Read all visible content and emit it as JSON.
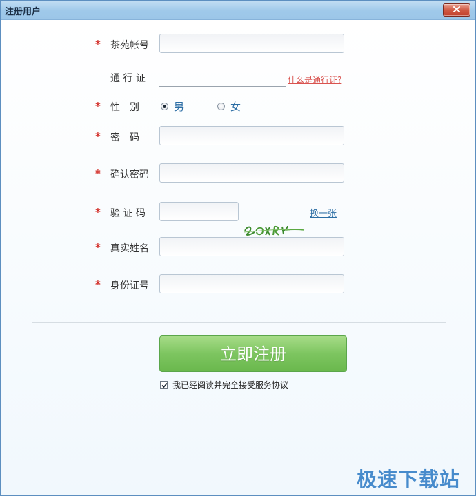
{
  "window": {
    "title": "注册用户"
  },
  "form": {
    "account": {
      "label": "茶苑帐号",
      "required_mark": "*",
      "value": ""
    },
    "passport": {
      "label": "通 行 证",
      "value": "",
      "help_link": "什么是通行证?"
    },
    "gender": {
      "label": "性　别",
      "required_mark": "*",
      "options": [
        {
          "label": "男",
          "selected": true
        },
        {
          "label": "女",
          "selected": false
        }
      ]
    },
    "password": {
      "label": "密　码",
      "required_mark": "*",
      "value": ""
    },
    "confirm_password": {
      "label": "确认密码",
      "required_mark": "*",
      "value": ""
    },
    "captcha": {
      "label": "验 证 码",
      "required_mark": "*",
      "value": "",
      "refresh_link": "换一张"
    },
    "real_name": {
      "label": "真实姓名",
      "required_mark": "*",
      "value": ""
    },
    "id_number": {
      "label": "身份证号",
      "required_mark": "*",
      "value": ""
    }
  },
  "register_button": {
    "label": "立即注册"
  },
  "agreement": {
    "checked": true,
    "text": "我已经阅读并完全接受服务协议"
  },
  "watermark": {
    "text": "极速下载站"
  },
  "colors": {
    "title_bar": "#9fc9ea",
    "required_star": "#d22a24",
    "passport_link": "#d9534f",
    "refresh_link": "#2c6ea5",
    "register_button": "#7dc560",
    "watermark": "#2a78c4"
  }
}
